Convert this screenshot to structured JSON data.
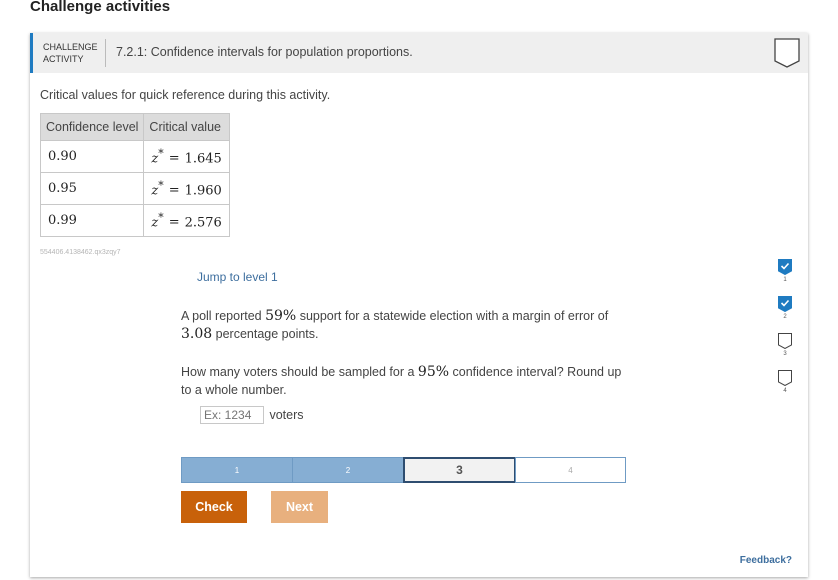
{
  "page": {
    "title": "Challenge activities"
  },
  "activity": {
    "label_line1": "CHALLENGE",
    "label_line2": "ACTIVITY",
    "title": "7.2.1: Confidence intervals for population proportions."
  },
  "critical_values": {
    "intro": "Critical values for quick reference during this activity.",
    "headers": [
      "Confidence level",
      "Critical value"
    ],
    "rows": [
      {
        "level": "0.90",
        "z": "1.645"
      },
      {
        "level": "0.95",
        "z": "1.960"
      },
      {
        "level": "0.99",
        "z": "2.576"
      }
    ],
    "z_symbol": "z",
    "star": "*",
    "equals": "="
  },
  "activity_id": "554406.4138462.qx3zqy7",
  "jump_text": "Jump to level 1",
  "question": {
    "p1_a": "A poll reported ",
    "p1_support": "59%",
    "p1_b": " support for a statewide election with a margin of error of ",
    "p1_margin": "3.08",
    "p1_c": " percentage points.",
    "p2_a": "How many voters should be sampled for a ",
    "p2_conf": "95%",
    "p2_b": " confidence interval? Round up to a whole number."
  },
  "answer": {
    "placeholder": "Ex: 1234",
    "unit": "voters"
  },
  "levels": [
    {
      "label": "1",
      "state": "done"
    },
    {
      "label": "2",
      "state": "done"
    },
    {
      "label": "3",
      "state": "current"
    },
    {
      "label": "4",
      "state": "todo"
    }
  ],
  "buttons": {
    "check": "Check",
    "next": "Next"
  },
  "side_levels": [
    {
      "num": "1",
      "checked": true
    },
    {
      "num": "2",
      "checked": true
    },
    {
      "num": "3",
      "checked": false
    },
    {
      "num": "4",
      "checked": false
    }
  ],
  "feedback": "Feedback?",
  "colors": {
    "accent": "#1f7bc1",
    "check_button": "#c8610a",
    "next_button": "#e8b07e",
    "level_done": "#86aed3"
  }
}
